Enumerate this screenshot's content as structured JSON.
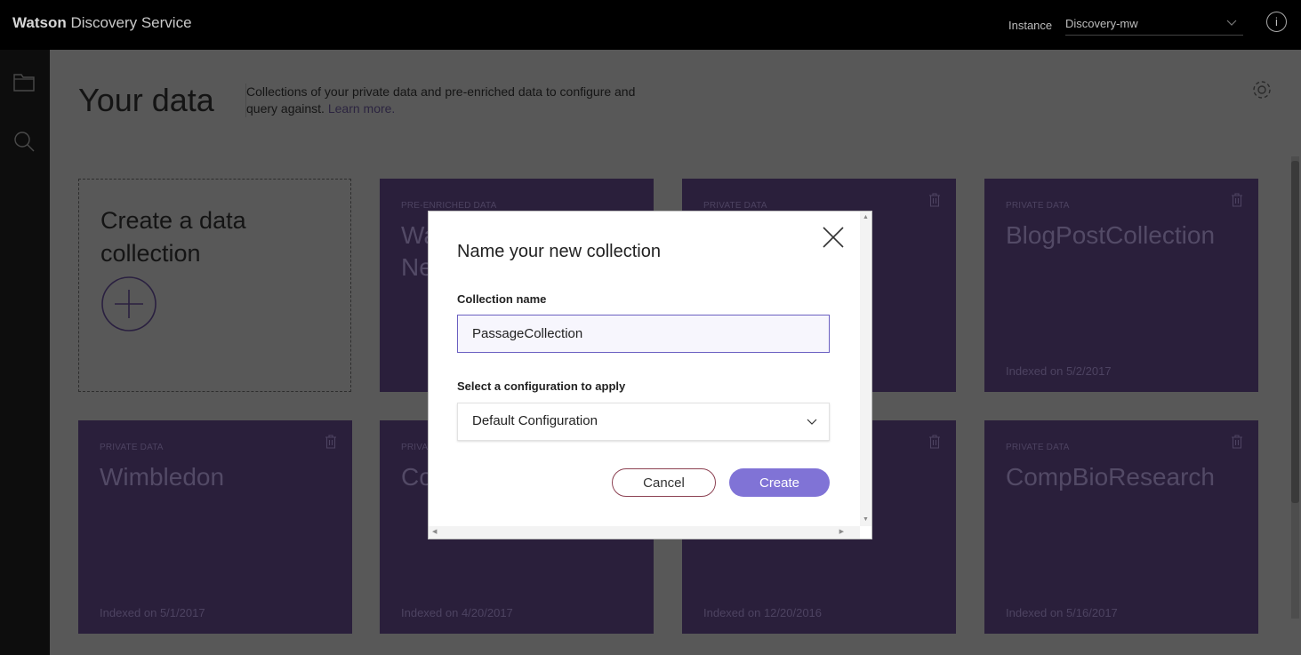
{
  "topbar": {
    "brand_bold": "Watson",
    "brand_rest": " Discovery Service",
    "instance_label": "Instance",
    "instance_value": "Discovery-mw",
    "info_symbol": "i"
  },
  "page": {
    "title": "Your data",
    "description": "Collections of your private data and pre-enriched data to configure and query against.",
    "learn_more": "Learn more."
  },
  "create_tile": {
    "title": "Create a data collection"
  },
  "tiles": [
    {
      "kind": "PRE-ENRICHED DATA",
      "name": "Wa\nNe",
      "date": ""
    },
    {
      "kind": "PRIVATE DATA",
      "name": "",
      "date": ""
    },
    {
      "kind": "PRIVATE DATA",
      "name": "BlogPostCollection",
      "date": "Indexed on 5/2/2017"
    },
    {
      "kind": "PRIVATE DATA",
      "name": "Wimbledon",
      "date": "Indexed on 5/1/2017"
    },
    {
      "kind": "PRIVA",
      "name": "Co",
      "date": "Indexed on 4/20/2017"
    },
    {
      "kind": "",
      "name": "",
      "date": "Indexed on 12/20/2016"
    },
    {
      "kind": "PRIVATE DATA",
      "name": "CompBioResearch",
      "date": "Indexed on 5/16/2017"
    }
  ],
  "modal": {
    "title": "Name your new collection",
    "name_label": "Collection name",
    "name_value": "PassageCollection",
    "config_label": "Select a configuration to apply",
    "config_value": "Default Configuration",
    "cancel_label": "Cancel",
    "create_label": "Create"
  },
  "colors": {
    "accent": "#8073d6",
    "tile_bg": "#2a1f3b",
    "topbar_bg": "#000000"
  },
  "icons": [
    "folder-icon",
    "search-icon",
    "gear-icon",
    "info-icon",
    "trash-icon",
    "plus-icon",
    "close-icon",
    "chevron-down-icon"
  ]
}
